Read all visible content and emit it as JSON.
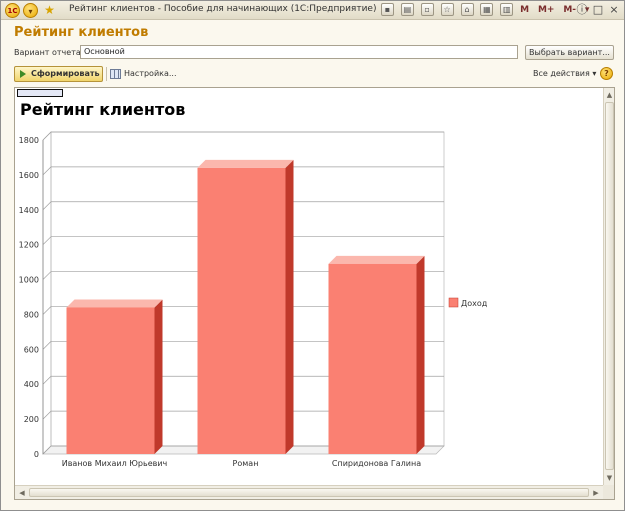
{
  "window": {
    "title": "Рейтинг клиентов - Пособие для начинающих  (1С:Предприятие)",
    "logo_text": "1С",
    "toolbar_m_labels": [
      "M",
      "M+",
      "M-"
    ]
  },
  "header": {
    "title": "Рейтинг клиентов",
    "variant_label": "Вариант отчета:",
    "variant_value": "Основной",
    "select_variant_button": "Выбрать вариант..."
  },
  "toolbar": {
    "form_button": "Сформировать",
    "settings_button": "Настройка...",
    "all_actions": "Все действия ▾",
    "help": "?"
  },
  "report": {
    "title": "Рейтинг клиентов"
  },
  "colors": {
    "bar_front": "#fa8072",
    "bar_top": "#fbb7ad",
    "bar_side": "#c0392b",
    "accent_title": "#c07c00"
  },
  "chart_data": {
    "type": "bar",
    "categories": [
      "Иванов Михаил Юрьевич",
      "Роман",
      "Спиридонова Галина"
    ],
    "series": [
      {
        "name": "Доход",
        "values": [
          840,
          1640,
          1090
        ]
      }
    ],
    "ylim": [
      0,
      1800
    ],
    "yticks": [
      0,
      200,
      400,
      600,
      800,
      1000,
      1200,
      1400,
      1600,
      1800
    ],
    "grid": true,
    "legend": "right",
    "style": "3d"
  }
}
